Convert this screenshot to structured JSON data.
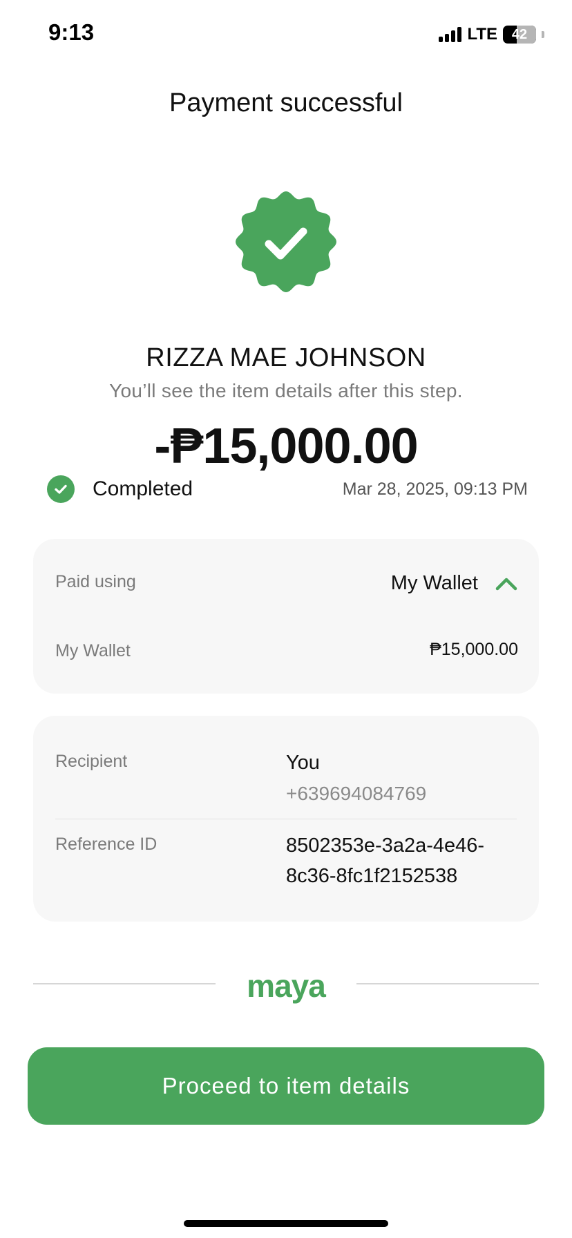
{
  "status_bar": {
    "time": "9:13",
    "network": "LTE",
    "battery_level": "42",
    "battery_fraction": 0.42
  },
  "header": {
    "title": "Payment successful"
  },
  "badge": {
    "icon": "verified-check-badge-icon",
    "color": "#4aa55c"
  },
  "payee": {
    "name": "RIZZA MAE JOHNSON",
    "hint": "You’ll see the item details after this step."
  },
  "amount": "-₱15,000.00",
  "transaction": {
    "status": "Completed",
    "datetime": "Mar 28, 2025, 09:13 PM"
  },
  "payment_card": {
    "paid_using_label": "Paid using",
    "paid_using_value": "My Wallet",
    "source_label": "My Wallet",
    "source_amount": "₱15,000.00"
  },
  "details_card": {
    "recipient_label": "Recipient",
    "recipient_name": "You",
    "recipient_number": "+639694084769",
    "reference_label": "Reference ID",
    "reference_value": "8502353e-3a2a-4e46-8c36-8fc1f2152538"
  },
  "brand": {
    "logo_text": "maya"
  },
  "cta": {
    "label": "Proceed to item details"
  },
  "colors": {
    "accent": "#4aa55c",
    "card_bg": "#f7f7f7"
  }
}
